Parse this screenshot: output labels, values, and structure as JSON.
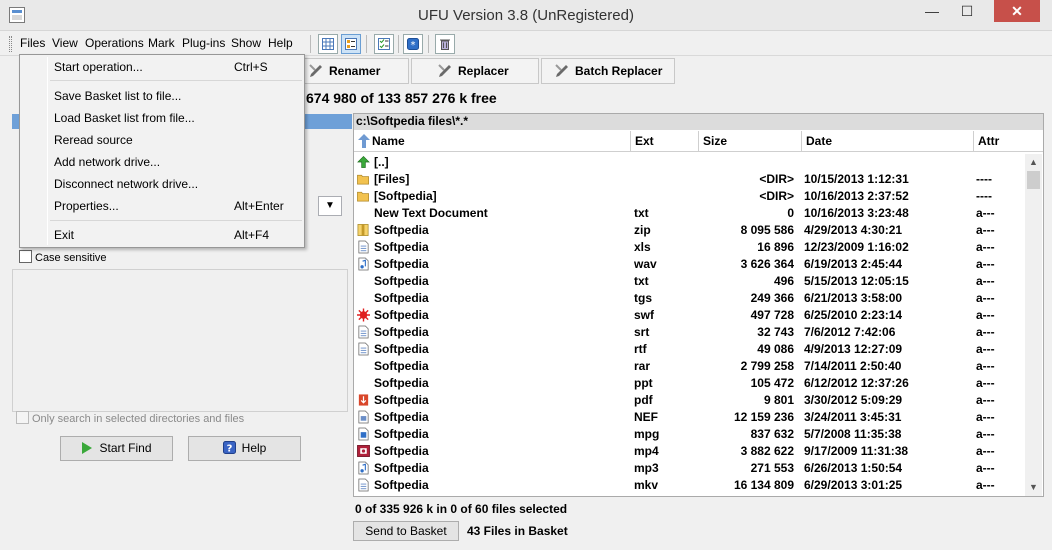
{
  "window": {
    "title": "UFU Version 3.8 (UnRegistered)",
    "minimize": "—",
    "maximize": "☐",
    "close": "✕"
  },
  "menubar": {
    "items": [
      "Files",
      "View",
      "Operations",
      "Mark",
      "Plug-ins",
      "Show",
      "Help"
    ]
  },
  "toolbar": {
    "icons": [
      "grid-view-icon",
      "detail-view-icon",
      "checklist-icon",
      "star-badge-icon",
      "trash-icon"
    ]
  },
  "tool_tabs": [
    {
      "label": "Renamer",
      "icon": "renamer-icon"
    },
    {
      "label": "Replacer",
      "icon": "replacer-icon"
    },
    {
      "label": "Batch Replacer",
      "icon": "batch-replacer-icon"
    }
  ],
  "disk_free": "674 980 of 133 857 276 k free",
  "files_menu": {
    "items": [
      {
        "label": "Start operation...",
        "shortcut": "Ctrl+S"
      },
      {
        "label": "Save Basket list to file...",
        "shortcut": ""
      },
      {
        "label": "Load Basket list from file...",
        "shortcut": ""
      },
      {
        "label": "Reread source",
        "shortcut": ""
      },
      {
        "label": "Add network drive...",
        "shortcut": ""
      },
      {
        "label": "Disconnect network drive...",
        "shortcut": ""
      },
      {
        "label": "Properties...",
        "shortcut": "Alt+Enter"
      },
      {
        "label": "Exit",
        "shortcut": "Alt+F4"
      }
    ]
  },
  "search": {
    "case_sensitive": "Case sensitive",
    "only_selected": "Only search in selected directories and files",
    "start_find": "Start Find",
    "help": "Help"
  },
  "file_list": {
    "path": "c:\\Softpedia files\\*.*",
    "columns": [
      "Name",
      "Ext",
      "Size",
      "Date",
      "Attr"
    ],
    "rows": [
      {
        "icon": "up-folder-icon",
        "name": "[..]",
        "ext": "",
        "size": "",
        "date": "",
        "attr": ""
      },
      {
        "icon": "folder-icon",
        "name": "[Files]",
        "ext": "",
        "size": "<DIR>",
        "date": "10/15/2013 1:12:31",
        "attr": "----"
      },
      {
        "icon": "folder-icon",
        "name": "[Softpedia]",
        "ext": "",
        "size": "<DIR>",
        "date": "10/16/2013 2:37:52",
        "attr": "----"
      },
      {
        "icon": "",
        "name": "New Text Document",
        "ext": "txt",
        "size": "0",
        "date": "10/16/2013 3:23:48",
        "attr": "a---"
      },
      {
        "icon": "zip-file-icon",
        "name": "Softpedia",
        "ext": "zip",
        "size": "8 095 586",
        "date": "4/29/2013 4:30:21",
        "attr": "a---"
      },
      {
        "icon": "document-icon",
        "name": "Softpedia",
        "ext": "xls",
        "size": "16 896",
        "date": "12/23/2009 1:16:02",
        "attr": "a---"
      },
      {
        "icon": "audio-file-icon",
        "name": "Softpedia",
        "ext": "wav",
        "size": "3 626 364",
        "date": "6/19/2013 2:45:44",
        "attr": "a---"
      },
      {
        "icon": "",
        "name": "Softpedia",
        "ext": "txt",
        "size": "496",
        "date": "5/15/2013 12:05:15",
        "attr": "a---"
      },
      {
        "icon": "",
        "name": "Softpedia",
        "ext": "tgs",
        "size": "249 366",
        "date": "6/21/2013 3:58:00",
        "attr": "a---"
      },
      {
        "icon": "flash-file-icon",
        "name": "Softpedia",
        "ext": "swf",
        "size": "497 728",
        "date": "6/25/2010 2:23:14",
        "attr": "a---"
      },
      {
        "icon": "document-icon",
        "name": "Softpedia",
        "ext": "srt",
        "size": "32 743",
        "date": "7/6/2012 7:42:06",
        "attr": "a---"
      },
      {
        "icon": "document-icon",
        "name": "Softpedia",
        "ext": "rtf",
        "size": "49 086",
        "date": "4/9/2013 12:27:09",
        "attr": "a---"
      },
      {
        "icon": "",
        "name": "Softpedia",
        "ext": "rar",
        "size": "2 799 258",
        "date": "7/14/2011 2:50:40",
        "attr": "a---"
      },
      {
        "icon": "",
        "name": "Softpedia",
        "ext": "ppt",
        "size": "105 472",
        "date": "6/12/2012 12:37:26",
        "attr": "a---"
      },
      {
        "icon": "pdf-file-icon",
        "name": "Softpedia",
        "ext": "pdf",
        "size": "9 801",
        "date": "3/30/2012 5:09:29",
        "attr": "a---"
      },
      {
        "icon": "image-file-icon",
        "name": "Softpedia",
        "ext": "NEF",
        "size": "12 159 236",
        "date": "3/24/2011 3:45:31",
        "attr": "a---"
      },
      {
        "icon": "video-file-icon",
        "name": "Softpedia",
        "ext": "mpg",
        "size": "837 632",
        "date": "5/7/2008 11:35:38",
        "attr": "a---"
      },
      {
        "icon": "mp4-file-icon",
        "name": "Softpedia",
        "ext": "mp4",
        "size": "3 882 622",
        "date": "9/17/2009 11:31:38",
        "attr": "a---"
      },
      {
        "icon": "audio-file-icon",
        "name": "Softpedia",
        "ext": "mp3",
        "size": "271 553",
        "date": "6/26/2013 1:50:54",
        "attr": "a---"
      },
      {
        "icon": "document-icon",
        "name": "Softpedia",
        "ext": "mkv",
        "size": "16 134 809",
        "date": "6/29/2013 3:01:25",
        "attr": "a---"
      }
    ]
  },
  "status": {
    "selection": "0 of 335 926 k in 0 of 60 files selected",
    "send_to_basket": "Send to Basket",
    "basket_count": "43 Files in Basket"
  }
}
